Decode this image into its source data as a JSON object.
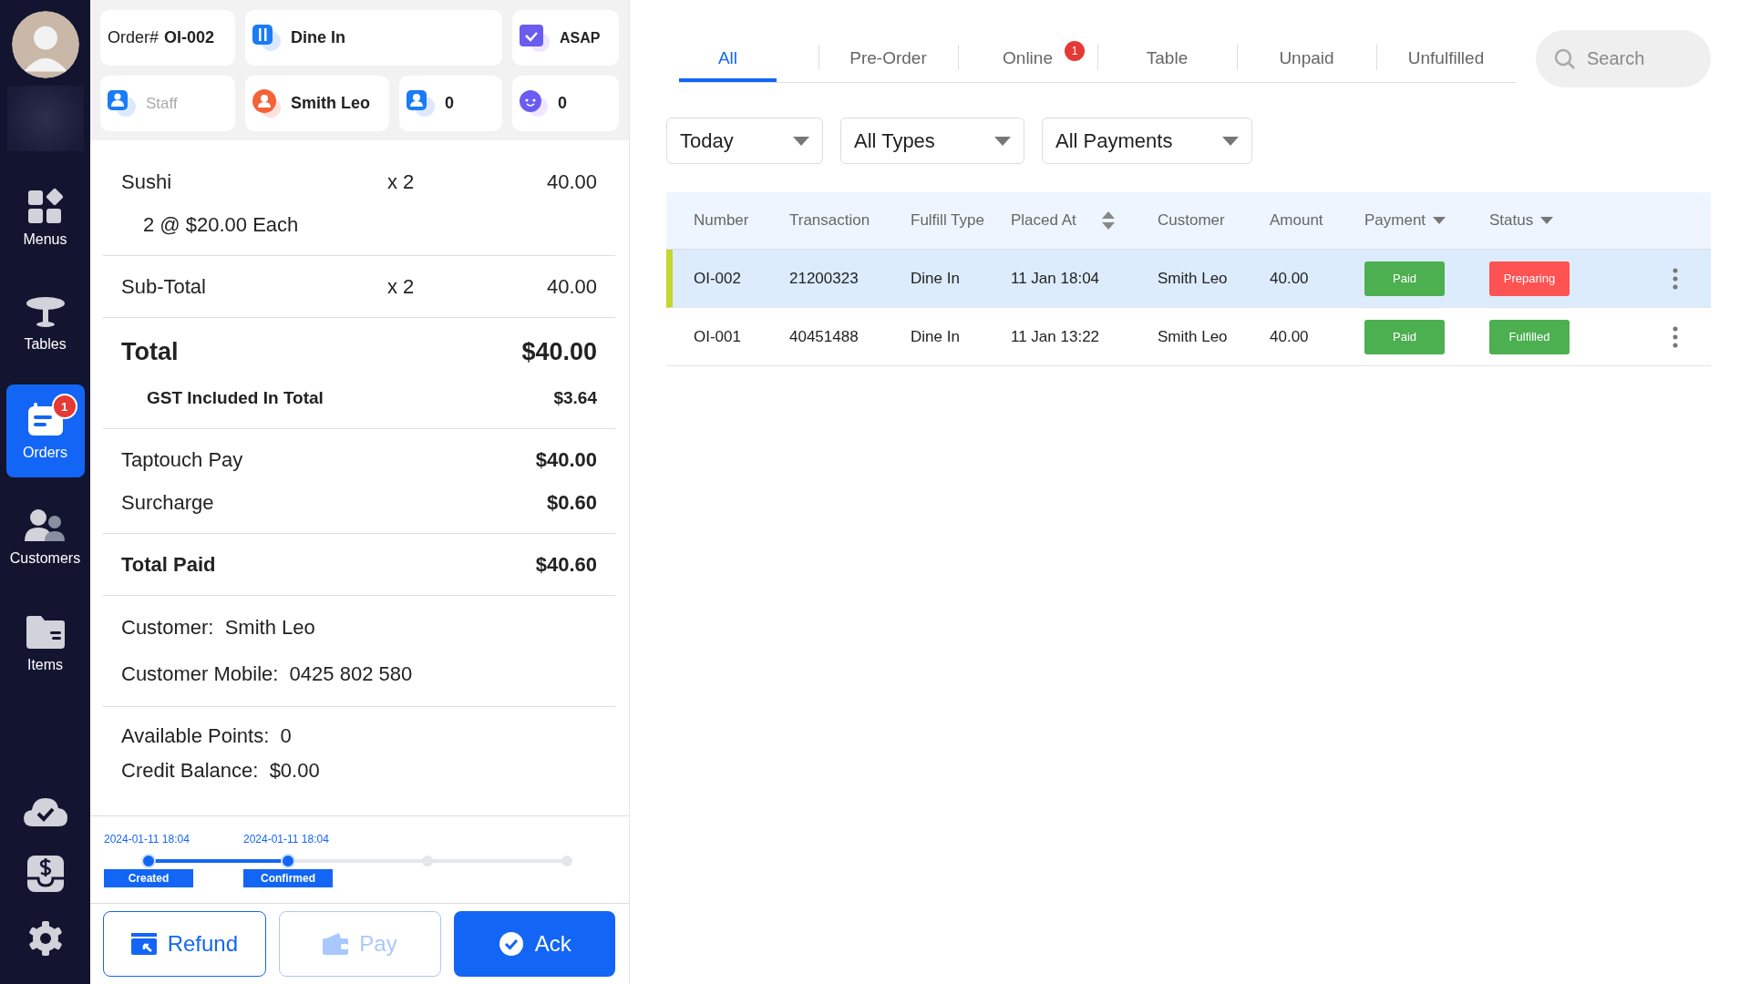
{
  "sidebar": {
    "nav": [
      {
        "label": "Menus",
        "selected": false
      },
      {
        "label": "Tables",
        "selected": false
      },
      {
        "label": "Orders",
        "selected": true,
        "badge": "1"
      },
      {
        "label": "Customers",
        "selected": false
      },
      {
        "label": "Items",
        "selected": false
      }
    ]
  },
  "order_header": {
    "order_label": "Order#",
    "order_number": "OI-002",
    "fulfill_type": "Dine In",
    "time": "ASAP",
    "staff": {
      "placeholder": "Staff"
    },
    "customer": "Smith Leo",
    "adults": "0",
    "children": "0"
  },
  "items": [
    {
      "name": "Sushi",
      "qty": "x 2",
      "amount": "40.00",
      "detail": "2 @ $20.00 Each"
    }
  ],
  "subtotal": {
    "label": "Sub-Total",
    "qty": "x 2",
    "amount": "40.00"
  },
  "total": {
    "label": "Total",
    "amount": "$40.00"
  },
  "gst": {
    "label": "GST Included In Total",
    "amount": "$3.64"
  },
  "payments": [
    {
      "label": "Taptouch Pay",
      "amount": "$40.00"
    },
    {
      "label": "Surcharge",
      "amount": "$0.60"
    }
  ],
  "total_paid": {
    "label": "Total Paid",
    "amount": "$40.60"
  },
  "customer_info": [
    {
      "label": "Customer:",
      "value": "Smith Leo"
    },
    {
      "label": "Customer Mobile:",
      "value": "0425 802 580"
    }
  ],
  "loyalty": [
    {
      "label": "Available Points:",
      "value": "0"
    },
    {
      "label": "Credit Balance:",
      "value": "$0.00"
    }
  ],
  "timeline": [
    {
      "time": "2024-01-11 18:04",
      "label": "Created",
      "done": true
    },
    {
      "time": "2024-01-11 18:04",
      "label": "Confirmed",
      "done": true
    },
    {
      "done": false
    },
    {
      "done": false
    }
  ],
  "actions": [
    {
      "label": "Refund",
      "kind": "outline",
      "disabled": false
    },
    {
      "label": "Pay",
      "kind": "outline",
      "disabled": true
    },
    {
      "label": "Ack",
      "kind": "primary",
      "disabled": false
    }
  ],
  "tabs": [
    {
      "label": "All",
      "selected": true
    },
    {
      "label": "Pre-Order",
      "selected": false
    },
    {
      "label": "Online",
      "selected": false,
      "badge": "1"
    },
    {
      "label": "Table",
      "selected": false
    },
    {
      "label": "Unpaid",
      "selected": false
    },
    {
      "label": "Unfulfilled",
      "selected": false
    }
  ],
  "search": {
    "placeholder": "Search"
  },
  "filters": [
    {
      "value": "Today"
    },
    {
      "value": "All Types"
    },
    {
      "value": "All Payments"
    }
  ],
  "table": {
    "columns": [
      {
        "label": "Number",
        "kind": "plain"
      },
      {
        "label": "Transaction",
        "kind": "plain"
      },
      {
        "label": "Fulfill Type",
        "kind": "plain"
      },
      {
        "label": "Placed At",
        "kind": "sortable"
      },
      {
        "label": "Customer",
        "kind": "plain"
      },
      {
        "label": "Amount",
        "kind": "plain"
      },
      {
        "label": "Payment",
        "kind": "menu"
      },
      {
        "label": "Status",
        "kind": "menu"
      }
    ],
    "rows": [
      {
        "selected": true,
        "cells": [
          "OI-002",
          "21200323",
          "Dine In",
          "11 Jan 18:04",
          "Smith Leo",
          "40.00"
        ],
        "payment": {
          "label": "Paid",
          "color": "#4caf50"
        },
        "status": {
          "label": "Preparing",
          "color": "#ff5252"
        }
      },
      {
        "selected": false,
        "cells": [
          "OI-001",
          "40451488",
          "Dine In",
          "11 Jan 13:22",
          "Smith Leo",
          "40.00"
        ],
        "payment": {
          "label": "Paid",
          "color": "#4caf50"
        },
        "status": {
          "label": "Fulfilled",
          "color": "#4caf50"
        }
      }
    ]
  }
}
